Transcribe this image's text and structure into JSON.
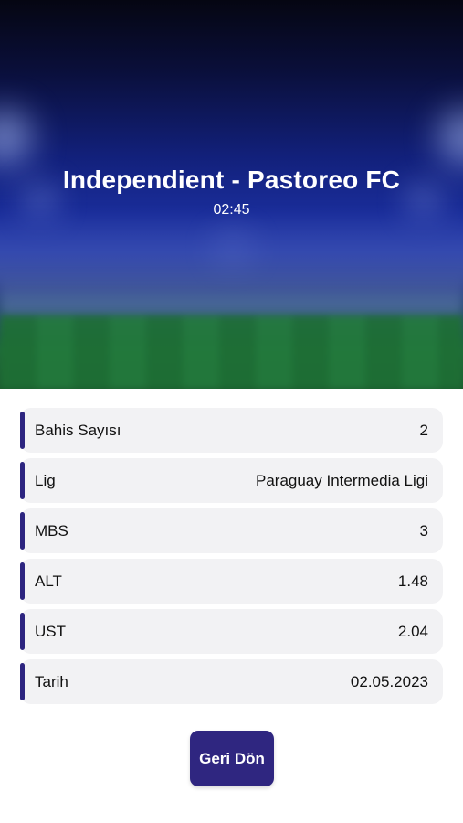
{
  "match": {
    "title": "Independient - Pastoreo FC",
    "time": "02:45"
  },
  "details": [
    {
      "label": "Bahis Sayısı",
      "value": "2"
    },
    {
      "label": "Lig",
      "value": "Paraguay Intermedia Ligi"
    },
    {
      "label": "MBS",
      "value": "3"
    },
    {
      "label": "ALT",
      "value": "1.48"
    },
    {
      "label": "UST",
      "value": "2.04"
    },
    {
      "label": "Tarih",
      "value": "02.05.2023"
    }
  ],
  "actions": {
    "back_label": "Geri Dön"
  },
  "colors": {
    "accent": "#2f2680",
    "row_background": "#f2f2f4"
  }
}
